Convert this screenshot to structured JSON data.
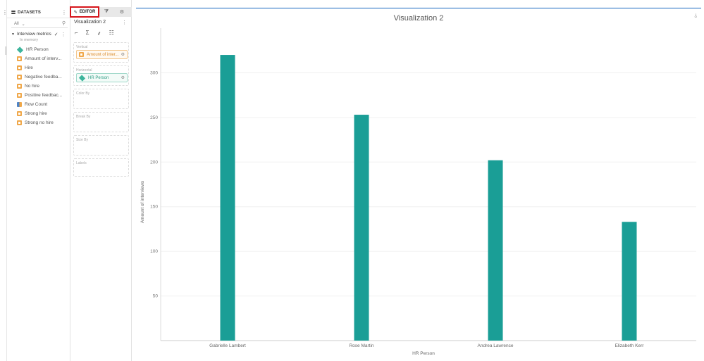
{
  "datasets": {
    "title": "DATASETS",
    "filter_value": "All",
    "group": {
      "name": "Interview metrics",
      "sub": "In memory"
    },
    "items": [
      {
        "type": "dimension",
        "label": "HR Person"
      },
      {
        "type": "measure",
        "label": "Amount of interv..."
      },
      {
        "type": "measure",
        "label": "Hire"
      },
      {
        "type": "measure",
        "label": "Negative feedba..."
      },
      {
        "type": "measure",
        "label": "No hire"
      },
      {
        "type": "measure",
        "label": "Positive feedbac..."
      },
      {
        "type": "count",
        "label": "Row Count"
      },
      {
        "type": "measure",
        "label": "Strong hire"
      },
      {
        "type": "measure",
        "label": "Strong no hire"
      }
    ]
  },
  "editor": {
    "tab_editor": "EDITOR",
    "viz_title": "Visualization 2",
    "shelves": [
      {
        "label": "Vertical",
        "pill": "Amount of inter...",
        "type": "measure"
      },
      {
        "label": "Horizontal",
        "pill": "HR Person",
        "type": "dimension"
      },
      {
        "label": "Color By"
      },
      {
        "label": "Break By"
      },
      {
        "label": "Size By"
      },
      {
        "label": "Labels"
      }
    ]
  },
  "chart_data": {
    "type": "bar",
    "title": "Visualization 2",
    "xlabel": "HR Person",
    "ylabel": "Amount of interviews",
    "categories": [
      "Gabrielle Lambert",
      "Rose Martin",
      "Andrea Lawrence",
      "Elizabeth Kerr"
    ],
    "values": [
      320,
      253,
      202,
      133
    ],
    "yticks": [
      50,
      100,
      150,
      200,
      250,
      300
    ],
    "ylim": [
      0,
      350
    ],
    "bar_color": "#1a9e96",
    "grid": true
  }
}
